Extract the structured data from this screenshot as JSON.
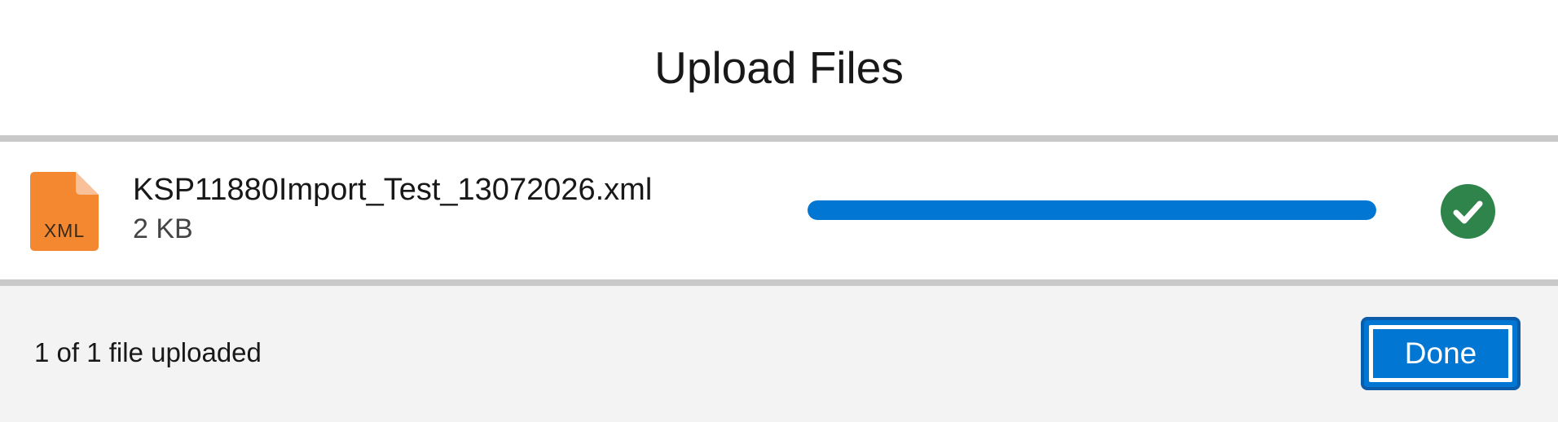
{
  "modal": {
    "title": "Upload Files"
  },
  "file": {
    "icon_name": "xml-file-icon",
    "type_label": "XML",
    "name": "KSP11880Import_Test_13072026.xml",
    "size": "2 KB",
    "progress_percent": 100,
    "status_icon": "success-check-icon"
  },
  "footer": {
    "status_text": "1 of 1 file uploaded",
    "done_label": "Done"
  },
  "colors": {
    "accent": "#0176d3",
    "success": "#2e844a",
    "file_icon": "#f38830",
    "footer_bg": "#f3f3f3"
  }
}
